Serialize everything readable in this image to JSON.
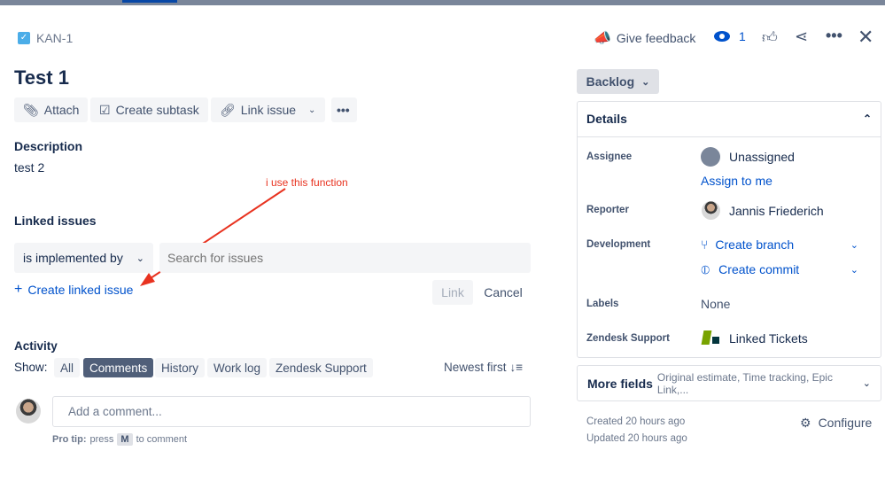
{
  "header": {
    "issue_key": "KAN-1",
    "give_feedback": "Give feedback",
    "watchers": "1"
  },
  "issue": {
    "title": "Test 1",
    "description_heading": "Description",
    "description": "test 2"
  },
  "toolbar": {
    "attach": "Attach",
    "create_subtask": "Create subtask",
    "link_issue": "Link issue"
  },
  "linked": {
    "heading": "Linked issues",
    "relation": "is implemented by",
    "search_placeholder": "Search for issues",
    "create_linked": "Create linked issue",
    "link_button": "Link",
    "cancel_button": "Cancel"
  },
  "annotation": {
    "text": "i use this function",
    "color": "#e8321f"
  },
  "activity": {
    "heading": "Activity",
    "show_label": "Show:",
    "filters": [
      "All",
      "Comments",
      "History",
      "Work log",
      "Zendesk Support"
    ],
    "active_filter": "Comments",
    "sort": "Newest first",
    "comment_placeholder": "Add a comment...",
    "pro_tip_bold": "Pro tip:",
    "pro_tip_pre": "press",
    "pro_tip_key": "M",
    "pro_tip_post": "to comment"
  },
  "sidebar": {
    "status": "Backlog",
    "details_heading": "Details",
    "assignee_label": "Assignee",
    "assignee": "Unassigned",
    "assign_to_me": "Assign to me",
    "reporter_label": "Reporter",
    "reporter": "Jannis Friederich",
    "development_label": "Development",
    "create_branch": "Create branch",
    "create_commit": "Create commit",
    "labels_label": "Labels",
    "labels": "None",
    "zendesk_label": "Zendesk Support",
    "zendesk_value": "Linked Tickets",
    "more_fields": "More fields",
    "more_fields_hint": "Original estimate, Time tracking, Epic Link,...",
    "created": "Created 20 hours ago",
    "updated": "Updated 20 hours ago",
    "configure": "Configure"
  },
  "colors": {
    "accent": "#0052cc",
    "active_pill": "#505f79",
    "issue_type": "#4bade8"
  }
}
